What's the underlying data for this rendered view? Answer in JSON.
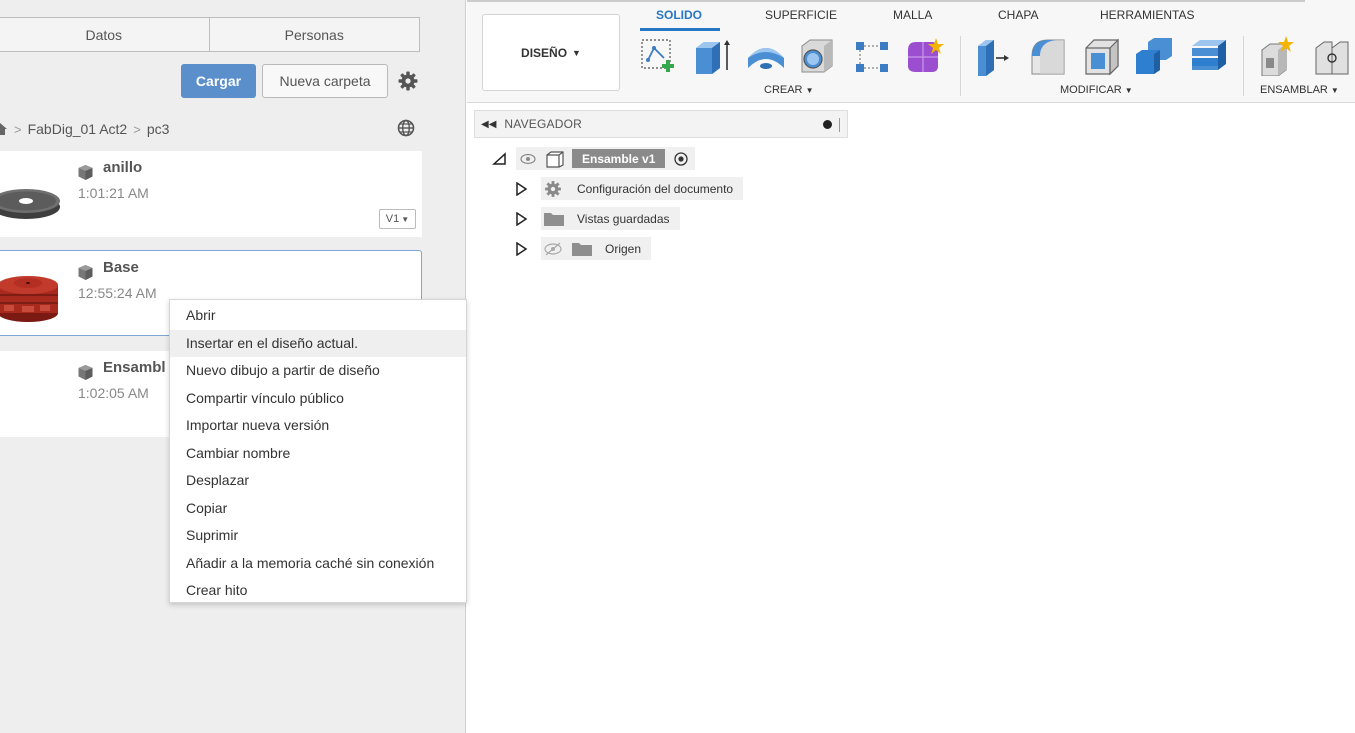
{
  "data_panel": {
    "tabs": [
      "Datos",
      "Personas"
    ],
    "upload_label": "Cargar",
    "new_folder_label": "Nueva carpeta",
    "breadcrumb": [
      "FabDig_01 Act2",
      "pc3"
    ],
    "files": [
      {
        "name": "anillo",
        "time": "1:01:21 AM",
        "version": "V1"
      },
      {
        "name": "Base",
        "time": "12:55:24 AM"
      },
      {
        "name": "Ensambl",
        "time": "1:02:05 AM"
      }
    ]
  },
  "context_menu": {
    "items": [
      "Abrir",
      "Insertar en el diseño actual.",
      "Nuevo dibujo a partir de diseño",
      "Compartir vínculo público",
      "Importar nueva versión",
      "Cambiar nombre",
      "Desplazar",
      "Copiar",
      "Suprimir",
      "Añadir a la memoria caché sin conexión",
      "Crear hito"
    ],
    "hovered_index": 1
  },
  "toolbar": {
    "workspace": "DISEÑO",
    "tabs": [
      "SOLIDO",
      "SUPERFICIE",
      "MALLA",
      "CHAPA",
      "HERRAMIENTAS"
    ],
    "active_tab": "SOLIDO",
    "groups": [
      "CREAR",
      "MODIFICAR",
      "ENSAMBLAR"
    ]
  },
  "navigator": {
    "title": "NAVEGADOR",
    "root": "Ensamble v1",
    "items": [
      "Configuración del documento",
      "Vistas guardadas",
      "Origen"
    ]
  },
  "colors": {
    "accent": "#2877c4",
    "upload_button": "#5a8fcb",
    "base_part": "#a8291d",
    "ring_part": "#5e5e5e"
  }
}
